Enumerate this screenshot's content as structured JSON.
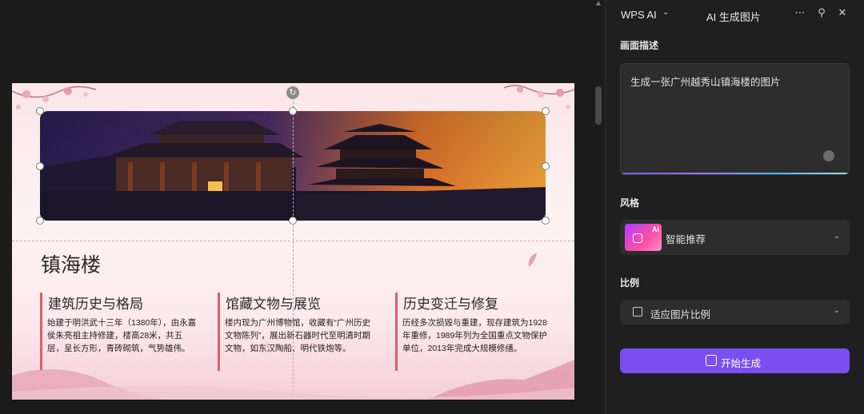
{
  "slide": {
    "title": "镇海楼",
    "columns": [
      {
        "heading": "建筑历史与格局",
        "body": "始建于明洪武十三年（1380年），由永嘉侯朱亮祖主持修建，楼高28米，共五层，呈长方形，青砖砌筑，气势雄伟。"
      },
      {
        "heading": "馆藏文物与展览",
        "body": "楼内现为广州博物馆，收藏有“广州历史文物陈列”，展出新石器时代至明清时期文物，如东汉陶船、明代铁炮等。"
      },
      {
        "heading": "历史变迁与修复",
        "body": "历经多次损毁与重建，现存建筑为1928年重修，1989年列为全国重点文物保护单位，2013年完成大规模修缮。"
      }
    ]
  },
  "panel": {
    "brand": "WPS AI",
    "title": "AI 生成图片",
    "icons": [
      "more-icon",
      "pin-icon",
      "close-icon"
    ],
    "description_label": "画面描述",
    "prompt_text": "生成一张广州越秀山镇海楼的图片",
    "style_label": "风格",
    "style_thumb_tag": "AI",
    "style_value": "智能推荐",
    "ratio_label": "比例",
    "ratio_value": "适应图片比例",
    "generate_label": "开始生成"
  },
  "colors": {
    "accent": "#7a4ff0",
    "panel_bg": "#1f1f1f",
    "slide_bar": "#d8606c"
  }
}
